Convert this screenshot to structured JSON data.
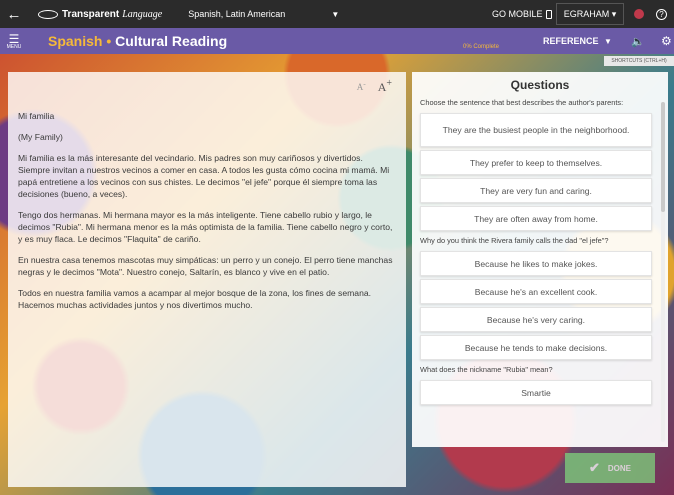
{
  "topbar": {
    "back_icon": "back-arrow-icon",
    "brand": "Transparent",
    "brand_word": "Language",
    "course": "Spanish, Latin American",
    "go_mobile": "GO MOBILE",
    "user": "EGRAHAM",
    "help": "?"
  },
  "header": {
    "menu_label": "MENU",
    "language": "Spanish",
    "separator": " • ",
    "title": "Cultural Reading",
    "progress": "0% Complete",
    "reference": "REFERENCE",
    "shortcuts": "SHORTCUTS (CTRL+H)"
  },
  "reading": {
    "title": "Mi familia",
    "subtitle": "(My Family)",
    "paragraphs": [
      "Mi familia es la más interesante del vecindario. Mis padres son muy cariñosos y divertidos. Siempre invitan a nuestros vecinos a comer en casa. A todos les gusta cómo cocina mi mamá. Mi papá entretiene a los vecinos con sus chistes. Le decimos \"el jefe\" porque él siempre toma las decisiones (bueno, a veces).",
      "Tengo dos hermanas. Mi hermana mayor es la más inteligente. Tiene cabello rubio y largo, le decimos \"Rubia\". Mi hermana menor es la más optimista de la familia. Tiene cabello negro y corto, y es muy flaca. Le decimos \"Flaquita\" de cariño.",
      "En nuestra casa tenemos mascotas muy simpáticas: un perro y un conejo. El perro tiene manchas negras y le decimos \"Mota\". Nuestro conejo, Saltarín, es blanco y vive en el patio.",
      "Todos en nuestra familia vamos a acampar al mejor bosque de la zona, los fines de semana. Hacemos muchas actividades juntos y nos divertimos mucho."
    ]
  },
  "questions": {
    "heading": "Questions",
    "items": [
      {
        "prompt": "Choose the sentence that best describes the author's parents:",
        "options": [
          "They are the busiest people in the neighborhood.",
          "They prefer to keep to themselves.",
          "They are very fun and caring.",
          "They are often away from home."
        ]
      },
      {
        "prompt": "Why do you think the Rivera family calls the dad \"el jefe\"?",
        "options": [
          "Because he likes to make jokes.",
          "Because he's an excellent cook.",
          "Because he's very caring.",
          "Because he tends to make decisions."
        ]
      },
      {
        "prompt": "What does the nickname \"Rubia\" mean?",
        "options": [
          "Smartie"
        ]
      }
    ]
  },
  "done_label": "DONE"
}
